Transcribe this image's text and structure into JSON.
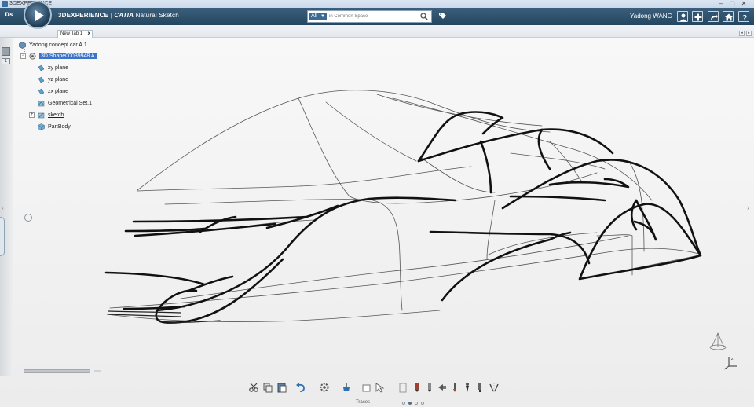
{
  "os_window": {
    "title": "3DEXPERIENCE",
    "controls": [
      "–",
      "▢",
      "✕"
    ]
  },
  "header": {
    "brand_main": "3DEXPERIENCE",
    "brand_sep": " | ",
    "brand_product": "CATIA",
    "app_name": "Natural Sketch",
    "search": {
      "scope": "All",
      "placeholder": "in Common Space"
    },
    "user": "Yadong WANG",
    "icons": [
      "user-icon",
      "plus-icon",
      "share-icon",
      "home-icon",
      "help-icon"
    ]
  },
  "tabs": [
    {
      "label": "New Tab 1",
      "close": "x"
    }
  ],
  "tree": {
    "root": "Yadong concept car A.1",
    "selected": "3D Shape00039948 A.",
    "children": [
      "xy plane",
      "yz plane",
      "zx plane",
      "Geometrical Set.1",
      "sketch",
      "PartBody"
    ]
  },
  "rail": {
    "button_label": "1"
  },
  "toolbar": {
    "section_label": "Traces",
    "pages": 4,
    "active_page": 2,
    "tools": [
      "cut-icon",
      "copy-icon",
      "paste-icon",
      "undo-icon",
      "settings-gear-icon",
      "brush-color-icon",
      "eraser-icon",
      "selection-icon",
      "paper-icon",
      "marker-icon",
      "pencil-icon",
      "spray-icon",
      "thin-brush-icon",
      "ink-pen-icon",
      "felt-tip-icon",
      "symmetry-brush-icon"
    ]
  },
  "colors": {
    "header_bg": "#2c5070",
    "selection": "#3c74c8",
    "canvas_bg": "#f1f1f1",
    "stroke": "#111111"
  }
}
